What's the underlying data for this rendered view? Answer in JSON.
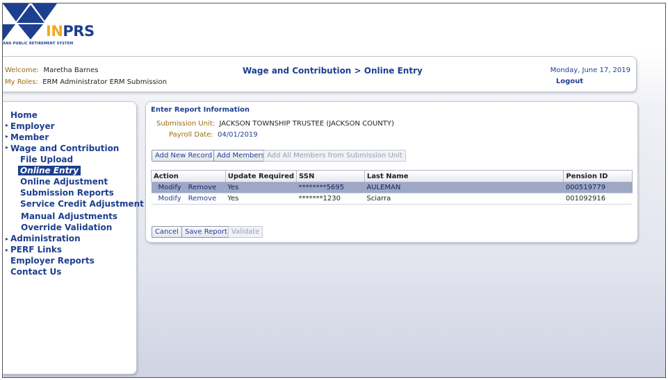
{
  "logo": {
    "brand_prefix": "IN",
    "brand_suffix": "PRS",
    "tagline": "ANA PUBLIC RETIREMENT SYSTEM",
    "colors": {
      "gold": "#f2a81d",
      "navy": "#1d3f8f"
    }
  },
  "header": {
    "welcome_label": "Welcome:",
    "welcome_name": "Maretha Barnes",
    "roles_label": "My Roles:",
    "roles_value": "ERM Administrator ERM Submission",
    "title": "Wage and Contribution > Online Entry",
    "date": "Monday, June 17, 2019",
    "logout": "Logout"
  },
  "sidebar": {
    "items": [
      {
        "label": "Home",
        "level": 1,
        "bullet": false
      },
      {
        "label": "Employer",
        "level": 1,
        "bullet": true
      },
      {
        "label": "Member",
        "level": 1,
        "bullet": true
      },
      {
        "label": "Wage and Contribution",
        "level": 1,
        "bullet": true
      },
      {
        "label": "File Upload",
        "level": 2
      },
      {
        "label": "Online Entry",
        "level": 2,
        "active": true
      },
      {
        "label": "Online Adjustment",
        "level": 2
      },
      {
        "label": "Submission Reports",
        "level": 2
      },
      {
        "label": "Service Credit Adjustment",
        "level": 2
      },
      {
        "label": "Manual Adjustments",
        "level": 2
      },
      {
        "label": "Override Validation",
        "level": 2
      },
      {
        "label": "Administration",
        "level": 1,
        "bullet": true
      },
      {
        "label": "PERF Links",
        "level": 1,
        "bullet": true
      },
      {
        "label": "Employer Reports",
        "level": 1,
        "bullet": false
      },
      {
        "label": "Contact Us",
        "level": 1,
        "bullet": false
      }
    ]
  },
  "report": {
    "section_title": "Enter Report Information",
    "submission_unit_label": "Submission Unit:",
    "submission_unit_value": "JACKSON TOWNSHIP TRUSTEE (JACKSON COUNTY)",
    "payroll_date_label": "Payroll Date:",
    "payroll_date_value": "04/01/2019",
    "buttons": {
      "add_new_record": "Add New Record",
      "add_members": "Add Members",
      "add_all_members": "Add All Members from Submission Unit",
      "cancel": "Cancel",
      "save_report": "Save Report",
      "validate": "Validate"
    },
    "table": {
      "headers": [
        "Action",
        "Update Required",
        "SSN",
        "Last Name",
        "Pension ID"
      ],
      "rows": [
        {
          "modify": "Modify",
          "remove": "Remove",
          "update_required": "Yes",
          "ssn": "********5695",
          "last_name": "AULEMAN",
          "pension_id": "000519779",
          "selected": true
        },
        {
          "modify": "Modify",
          "remove": "Remove",
          "update_required": "Yes",
          "ssn": "*******1230",
          "last_name": "Sciarra",
          "pension_id": "001092916",
          "selected": false
        }
      ]
    }
  }
}
